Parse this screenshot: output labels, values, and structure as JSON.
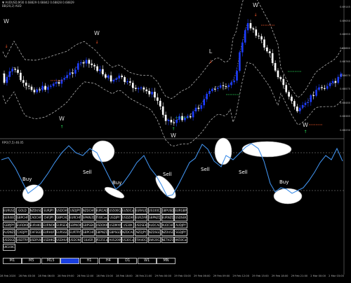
{
  "header": {
    "line1": "▼ AUDUSD,M30 0.68829 0.68842 0.68828 0.68829",
    "line2": "BB(20,2) AUD"
  },
  "indicator": {
    "label": "RPO(7,5) 46.05"
  },
  "signals": {
    "w": "W",
    "l": "L",
    "buy": "Buy",
    "sell": "Sell"
  },
  "symbols": [
    [
      "EURUSD",
      "GOLD",
      "NZDUSD",
      "EURJPY",
      "USDCHF",
      "USDJPY",
      "NZDCHF",
      "EURCAD",
      "US500Cash",
      "EU50Cash",
      "EURAUD",
      "US100Cash",
      "GBPUSD",
      "EURGBP"
    ],
    [
      "GER40Cash",
      "GBPCHF",
      "CADCHF",
      "CHFJPY",
      "GBPCAD",
      "EURCHF",
      "SPAIN35Cash",
      "IT40Cash",
      "USDJPY",
      "USDZAR",
      "EURZAR",
      "GBPNZD",
      "EURNZD",
      "USDSEK"
    ],
    [
      "GBPJPY",
      "EURDKK",
      "EURHKD",
      "EURNOK",
      "EURSEK",
      "GBPNOK",
      "GBPSEK",
      "USDDKK",
      "USDMXN",
      "US30K",
      "USDSEK",
      "AUDCAD",
      "AUDCHF",
      "AUDJPY"
    ],
    [
      "AUDNZD",
      "CADJPY",
      "CHFSGD",
      "EURHUF",
      "EURSGD",
      "EURTRY",
      "GBPCHF",
      "GBPNZD",
      "GBPSGD",
      "NZDCAD",
      "NZDJPY",
      "NZDSGD",
      "NZDUSD",
      "SGDJPY"
    ],
    [
      "USDSGD",
      "USDTRY",
      "USDPLN",
      "USDHKD",
      "USDHUF",
      "USDCNH",
      "SILVER",
      "JP225Cash",
      "AUS200Cash",
      "US30Cash",
      "FRA40Cash",
      "SWI20Cash",
      "NETH25Cash",
      "HK50Cash"
    ],
    [
      "UK100Cash"
    ]
  ],
  "timeframes": [
    "M1",
    "M5",
    "M15",
    "M30",
    "H1",
    "H4",
    "D1",
    "W1",
    "MN"
  ],
  "active_timeframe": "M30",
  "price_labels": [
    "0.69145",
    "0.69050",
    "0.68955",
    "0.68860",
    "0.68765",
    "0.68670",
    "0.68575",
    "0.68480",
    "0.68385",
    "0.68290"
  ],
  "time_labels": [
    "28 Feb 2020",
    "28 Feb 03:00",
    "28 Feb 06:00",
    "28 Feb 09:00",
    "28 Feb 12:00",
    "28 Feb 15:00",
    "28 Feb 18:00",
    "28 Feb 21:00",
    "29 Feb 00:00",
    "29 Feb 03:00",
    "29 Feb 06:00",
    "29 Feb 09:00",
    "29 Feb 12:00",
    "29 Feb 15:00",
    "29 Feb 18:00",
    "29 Feb 21:00",
    "2 Mar 00:00",
    "2 Mar 03:00"
  ],
  "colors": {
    "background": "#000000",
    "bull_candle": "#1c3cff",
    "bear_candle": "#ffffff",
    "bands": "#b0b0b0",
    "rpo_line": "#3f8fe8",
    "arrow_down": "#ff5a2a",
    "arrow_up": "#2adf5a",
    "highlight": "#ffffff"
  }
}
